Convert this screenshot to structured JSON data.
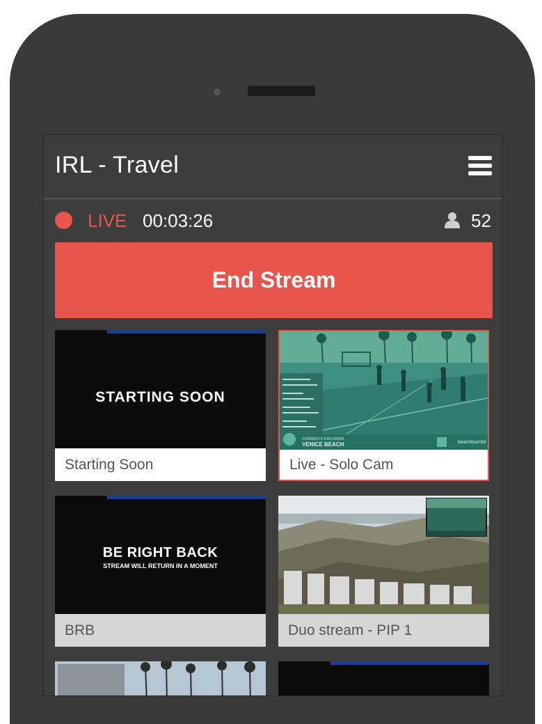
{
  "app": {
    "title": "IRL - Travel",
    "menu_icon": "hamburger-menu-icon"
  },
  "status": {
    "live_label": "LIVE",
    "timer": "00:03:26",
    "viewer_icon": "user-icon",
    "viewer_count": "52",
    "live_color": "#e8554c"
  },
  "end_stream": {
    "label": "End Stream",
    "color": "#e8554c"
  },
  "scenes": [
    {
      "label": "Starting Soon",
      "caption": "STARTING SOON",
      "active": false
    },
    {
      "label": "Live - Solo Cam",
      "caption": "VENICE BEACH",
      "overlay_text": "CURRENTLY EXPLORING",
      "active": true
    },
    {
      "label": "BRB",
      "caption": "BE RIGHT BACK",
      "subcaption": "STREAM WILL RETURN IN A MOMENT",
      "active": false
    },
    {
      "label": "Duo stream - PIP 1",
      "active": false
    }
  ]
}
